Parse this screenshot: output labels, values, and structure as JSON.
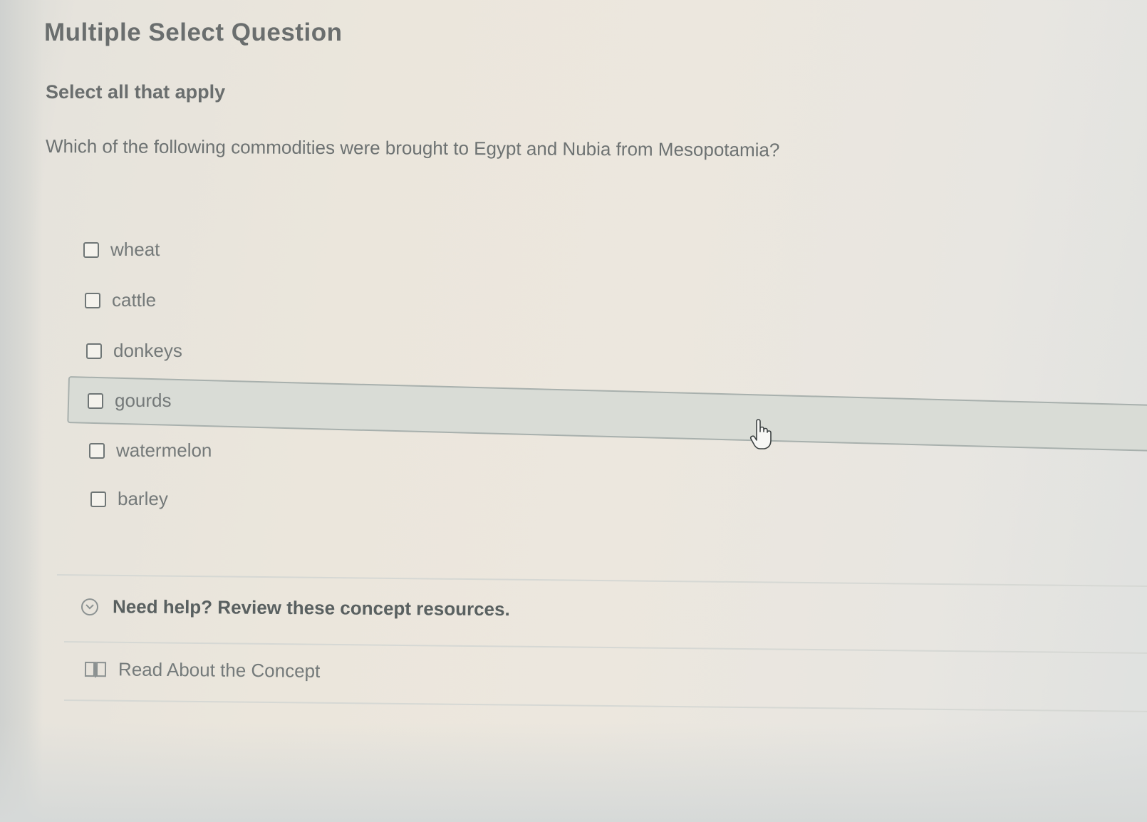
{
  "header": {
    "title": "Multiple Select Question",
    "instruction": "Select all that apply"
  },
  "question": {
    "text": "Which of the following commodities were brought to Egypt and Nubia from Mesopotamia?"
  },
  "options": [
    {
      "label": "wheat",
      "checked": false
    },
    {
      "label": "cattle",
      "checked": false
    },
    {
      "label": "donkeys",
      "checked": false
    },
    {
      "label": "gourds",
      "checked": false,
      "hovered": true
    },
    {
      "label": "watermelon",
      "checked": false
    },
    {
      "label": "barley",
      "checked": false
    }
  ],
  "help": {
    "toggle_label": "Need help? Review these concept resources.",
    "toggle_icon": "chevron-down-circle-icon",
    "resource_label": "Read About the Concept",
    "resource_icon": "book-icon"
  },
  "cursor": {
    "icon": "hand-pointer-icon"
  },
  "colors": {
    "highlight_fill": "#d9dcd6",
    "highlight_border": "#a8b0ad",
    "text": "#6a6e6e"
  }
}
